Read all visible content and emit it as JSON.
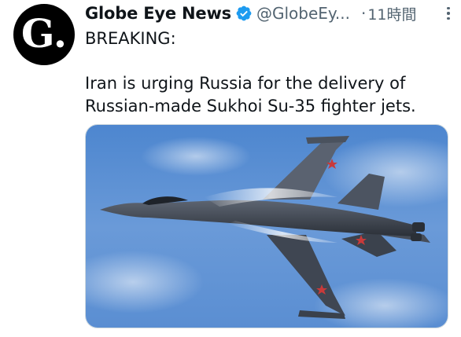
{
  "tweet": {
    "display_name": "Globe Eye News",
    "handle": "@GlobeEy...",
    "separator": "·",
    "timestamp": "11時間",
    "avatar_letter": "G.",
    "verified_icon": "verified-badge-icon",
    "more_icon": "more-vertical-icon",
    "text_line_1": "BREAKING:",
    "text_line_2": "Iran is urging Russia for the delivery of",
    "text_line_3": "Russian-made Sukhoi Su-35 fighter jets.",
    "media_description_icon": "fighter-jet-photo"
  },
  "colors": {
    "verified_blue": "#1d9bf0",
    "secondary_text": "#536471",
    "primary_text": "#0f1419",
    "sky": "#5b8fd0"
  }
}
